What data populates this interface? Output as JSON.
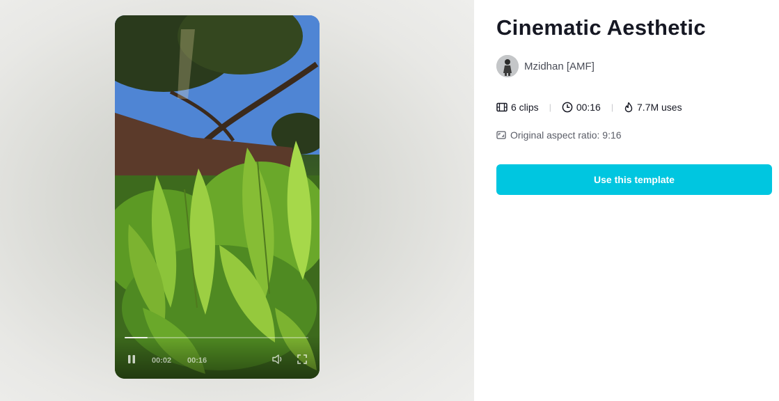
{
  "player": {
    "current_time": "00:02",
    "duration": "00:16",
    "progress": 0.125,
    "icons": {
      "play_pause": "pause-icon",
      "volume": "volume-icon",
      "fullscreen": "fullscreen-icon"
    }
  },
  "template": {
    "title": "Cinematic Aesthetic",
    "author": {
      "name": "Mzidhan [AMF]",
      "avatar_icon": "avatar-silhouette-icon"
    },
    "stats": {
      "clips": "6 clips",
      "duration": "00:16",
      "uses": "7.7M uses",
      "separator": "|"
    },
    "aspect_ratio": "Original aspect ratio: 9:16",
    "cta_label": "Use this template"
  },
  "colors": {
    "accent": "#00c6e0",
    "title_text": "#161823",
    "secondary_text": "#5a5d67",
    "page_background": "#ffffff"
  }
}
